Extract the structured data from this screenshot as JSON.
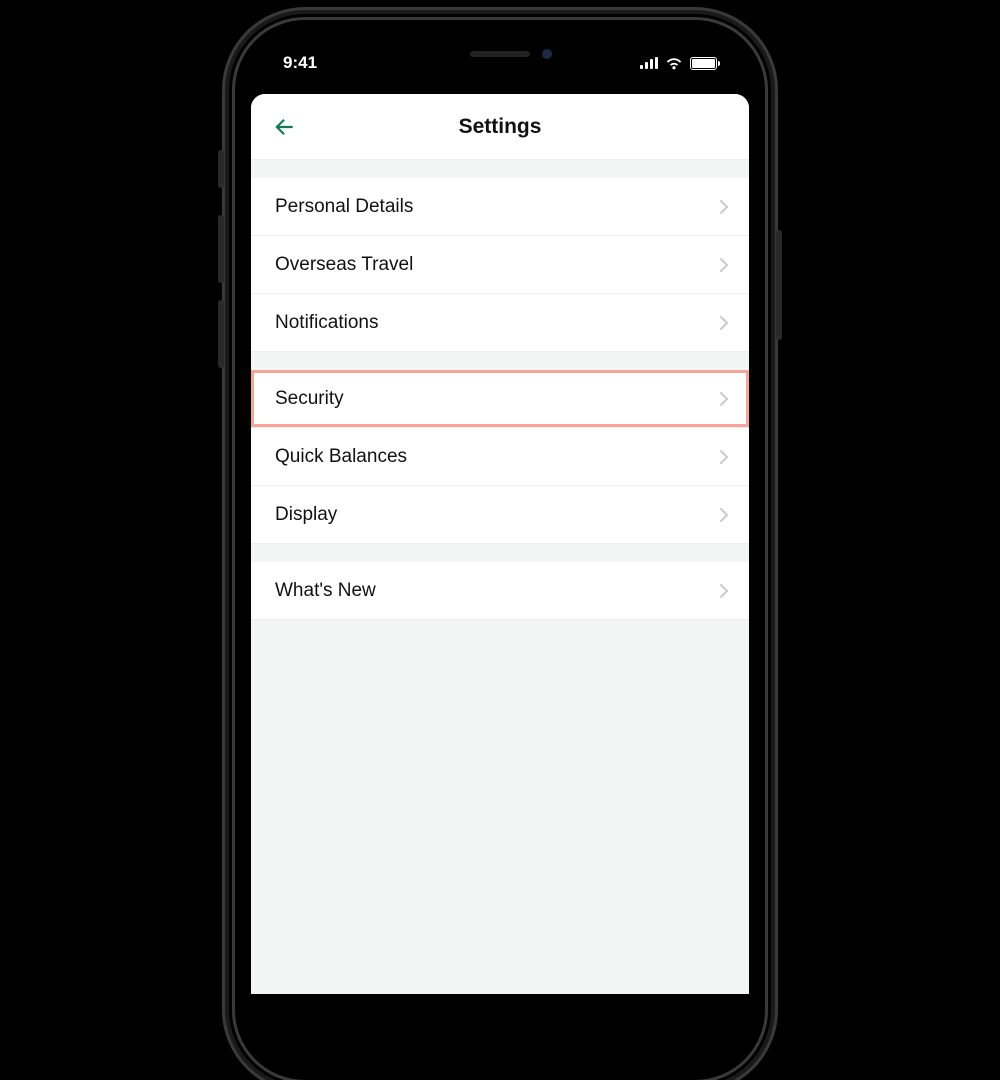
{
  "status_bar": {
    "time": "9:41"
  },
  "header": {
    "title": "Settings"
  },
  "sections": [
    {
      "items": [
        {
          "label": "Personal Details",
          "highlighted": false
        },
        {
          "label": "Overseas Travel",
          "highlighted": false
        },
        {
          "label": "Notifications",
          "highlighted": false
        }
      ]
    },
    {
      "items": [
        {
          "label": "Security",
          "highlighted": true
        },
        {
          "label": "Quick Balances",
          "highlighted": false
        },
        {
          "label": "Display",
          "highlighted": false
        }
      ]
    },
    {
      "items": [
        {
          "label": "What's New",
          "highlighted": false
        }
      ]
    }
  ],
  "colors": {
    "accent": "#0d7d4d",
    "highlight": "#f5a49a"
  }
}
